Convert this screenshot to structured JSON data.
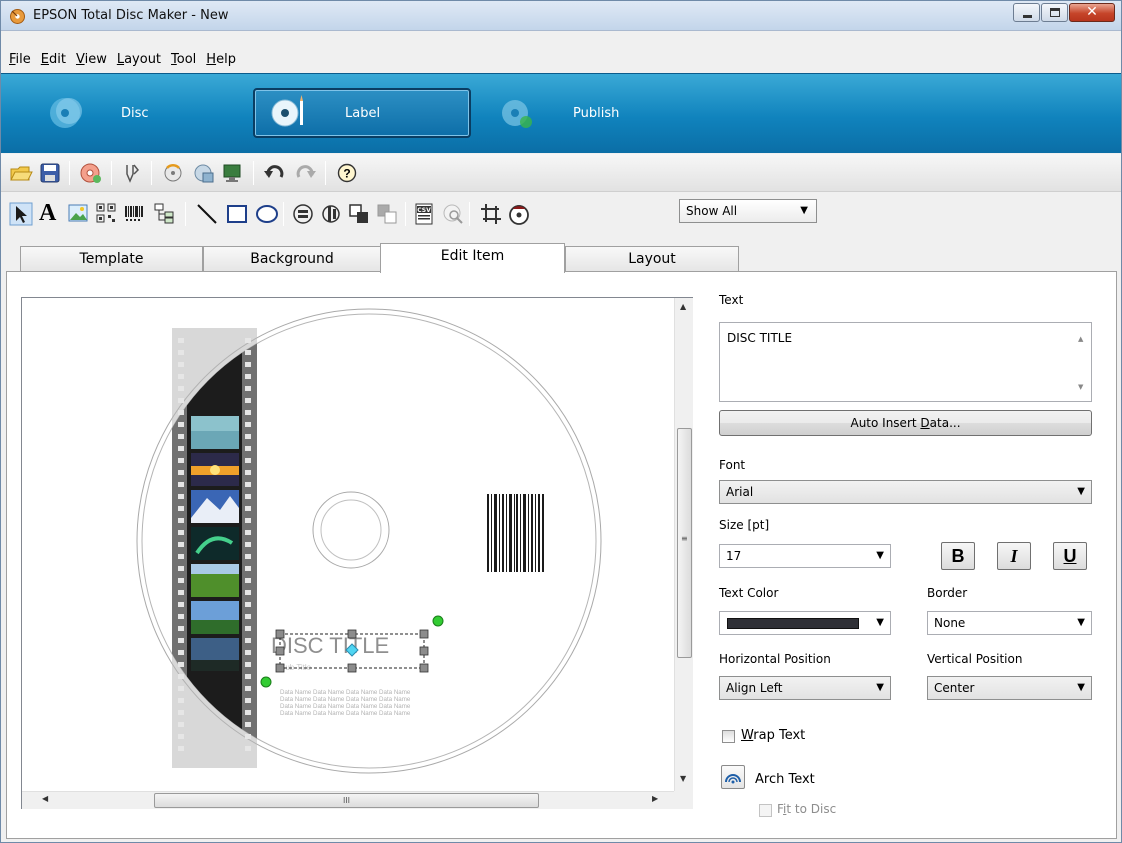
{
  "window": {
    "title": "EPSON Total Disc Maker - New"
  },
  "menu": [
    {
      "label": "File",
      "key": "F",
      "rest": "ile"
    },
    {
      "label": "Edit",
      "key": "E",
      "rest": "dit"
    },
    {
      "label": "View",
      "key": "V",
      "rest": "iew"
    },
    {
      "label": "Layout",
      "key": "L",
      "rest": "ayout"
    },
    {
      "label": "Tool",
      "key": "T",
      "rest": "ool"
    },
    {
      "label": "Help",
      "key": "H",
      "rest": "elp"
    }
  ],
  "modes": {
    "disc": "Disc",
    "label": "Label",
    "publish": "Publish"
  },
  "toolbar": {
    "view_filter": "Show All"
  },
  "tabs": {
    "template": "Template",
    "background": "Background",
    "edit_item": "Edit Item",
    "layout": "Layout"
  },
  "canvas": {
    "title_text": "DISC TITLE",
    "sub_text": "Sub Title",
    "data_lines": [
      "Data Name Data Name Data Name Data Name",
      "Data Name Data Name Data Name Data Name",
      "Data Name Data Name Data Name Data Name",
      "Data Name Data Name Data Name Data Name"
    ],
    "hscroll_grip": "III",
    "vscroll_grip": "≡"
  },
  "properties": {
    "text_label": "Text",
    "text_value": "DISC TITLE",
    "auto_insert_pre": "Auto Insert ",
    "auto_insert_key": "D",
    "auto_insert_post": "ata...",
    "font_label": "Font",
    "font_value": "Arial",
    "size_label": "Size [pt]",
    "size_value": "17",
    "bold": "B",
    "italic": "I",
    "underline": "U",
    "text_color_label": "Text Color",
    "text_color": "#2f3036",
    "border_label": "Border",
    "border_value": "None",
    "hpos_label": "Horizontal Position",
    "hpos_value": "Align Left",
    "vpos_label": "Vertical Position",
    "vpos_value": "Center",
    "wrap_key": "W",
    "wrap_rest": "rap Text",
    "arch_label": "Arch Text",
    "fit_pre": "F",
    "fit_key": "i",
    "fit_post": "t to Disc"
  }
}
